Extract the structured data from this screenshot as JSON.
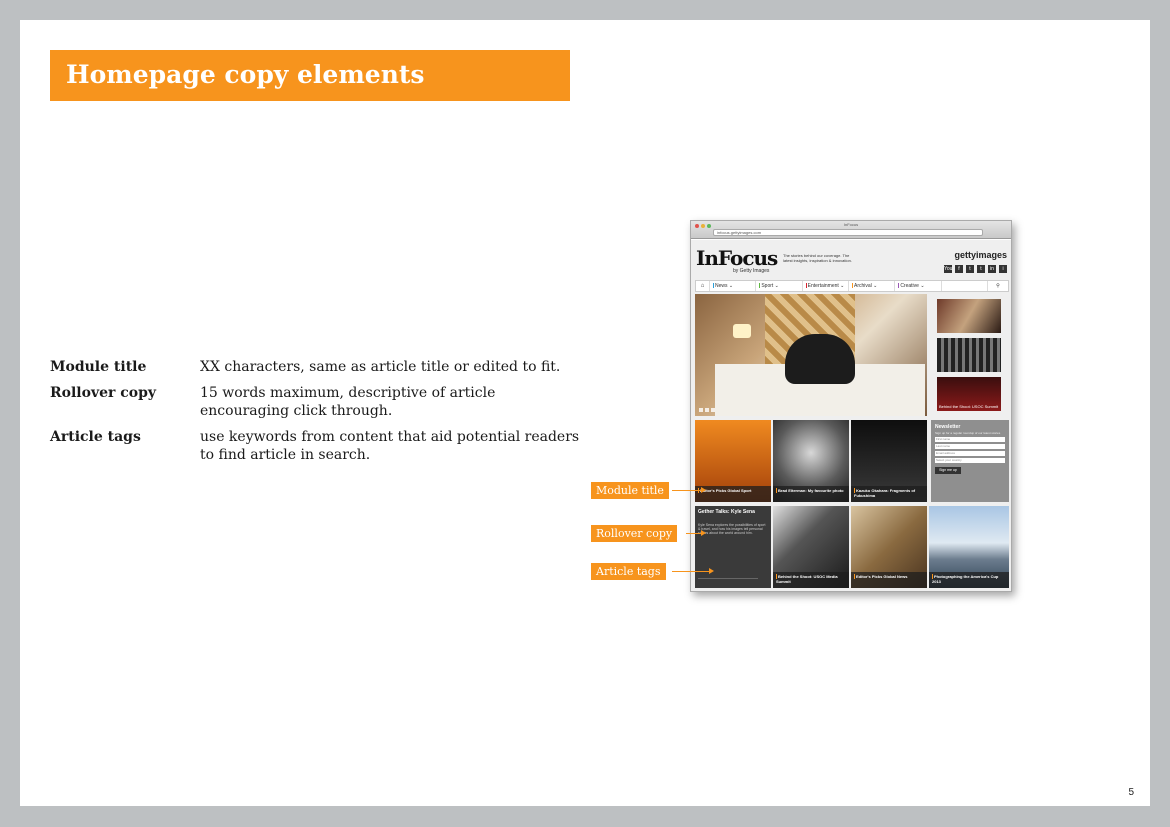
{
  "page": {
    "title": "Homepage copy elements",
    "page_number": "5"
  },
  "specs": [
    {
      "label": "Module title",
      "desc": "XX characters, same as article title or edited to fit."
    },
    {
      "label": "Rollover copy",
      "desc": "15 words maximum, descriptive of article encouraging click through."
    },
    {
      "label": "Article tags",
      "desc": "use keywords from content that aid potential readers to find article in search."
    }
  ],
  "callouts": {
    "module_title": "Module title",
    "rollover_copy": "Rollover copy",
    "article_tags": "Article tags"
  },
  "browser": {
    "window_title": "InFocus",
    "url": "infocus.gettyimages.com",
    "logo": "InFocus",
    "logo_sub": "by Getty Images",
    "tagline": "The stories behind our coverage. The latest insights, inspiration & innovation.",
    "getty": "gettyimages",
    "social": [
      "You",
      "f",
      "t",
      "t",
      "in",
      "i"
    ],
    "nav": [
      "News",
      "Sport",
      "Entertainment",
      "Archival",
      "Creative"
    ],
    "nav_colors": [
      "#2a9fd8",
      "#5fb843",
      "#d6242f",
      "#f7941d",
      "#9b59b6"
    ],
    "side_captions": [
      "",
      "",
      "Behind the Shoot: USOC Summit"
    ],
    "tiles": [
      {
        "caption": "Editor's Picks Global Sport"
      },
      {
        "caption": "Brad Elterman: My favourite photo"
      },
      {
        "caption": "Kazuko Okahara: Fragments of Fukushima"
      },
      {
        "caption": "Behind the Shoot: USOC Media Summit"
      },
      {
        "caption": "Editor's Picks Global News"
      },
      {
        "caption": "Photographing the America's Cup 2013"
      }
    ],
    "newsletter": {
      "title": "Newsletter",
      "text": "Sign up for a regular roundup of our latest stories",
      "fields": [
        "First name",
        "Last name",
        "Email address",
        "Select your country"
      ],
      "button": "Sign me up"
    },
    "rollover": {
      "title": "Gether Talks: Kyle Sena",
      "copy": "Kyle Sena explores the possibilities of sport & travel, and how his images tell personal stories about the world around him."
    }
  }
}
